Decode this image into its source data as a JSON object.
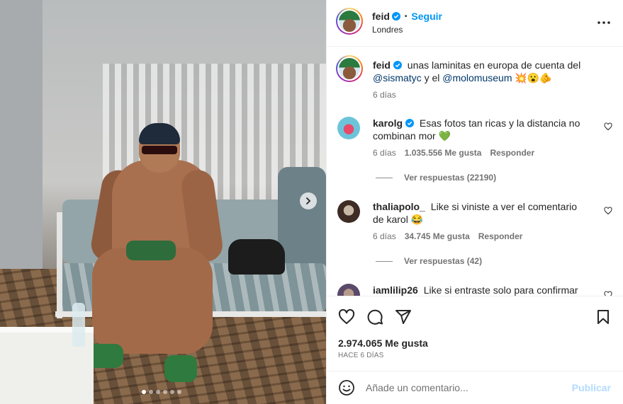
{
  "post": {
    "carousel": {
      "slide_count": 6,
      "active_slide": 1
    },
    "author": {
      "username": "feid",
      "verified": true,
      "follow_label": "Seguir",
      "location": "Londres"
    },
    "caption": {
      "username": "feid",
      "text_before": "unas laminitas en europa de cuenta del",
      "mention1": "@sismatyc",
      "text_middle": "y el",
      "mention2": "@molomuseum",
      "emojis": "💥😮🫵",
      "time": "6 días"
    },
    "comments": [
      {
        "username": "karolg",
        "verified": true,
        "text": "Esas fotos tan ricas y la distancia no combinan mor",
        "emoji": "💚",
        "time": "6 días",
        "likes": "1.035.556 Me gusta",
        "reply_label": "Responder",
        "view_replies": "Ver respuestas (22190)"
      },
      {
        "username": "thaliapolo_",
        "verified": false,
        "text": "Like si viniste a ver el comentario de karol",
        "emoji": "😂",
        "time": "6 días",
        "likes": "34.745 Me gusta",
        "reply_label": "Responder",
        "view_replies": "Ver respuestas (42)"
      },
      {
        "username": "iamlilip26",
        "verified": false,
        "text": "Like si entraste solo para confirmar el"
      }
    ],
    "likes_total": "2.974.065 Me gusta",
    "posted_ago": "HACE 6 DÍAS",
    "composer": {
      "placeholder": "Añade un comentario...",
      "post_label": "Publicar"
    },
    "colors": {
      "link": "#0095f6",
      "mention": "#00376b",
      "muted": "#737373",
      "disabled_post": "#b3dbff"
    }
  }
}
